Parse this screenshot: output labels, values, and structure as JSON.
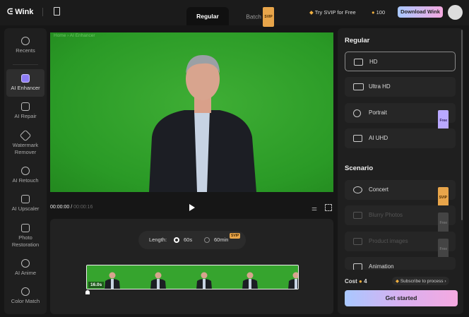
{
  "header": {
    "app_name": "Wink",
    "tabs": [
      {
        "label": "Regular"
      },
      {
        "label": "Batch",
        "badge": "SVIP"
      }
    ],
    "try_svip": "Try SVIP for Free",
    "coins": "100",
    "download": "Download Wink"
  },
  "breadcrumb": "Home  ›  AI Enhancer",
  "sidebar": {
    "items": [
      {
        "label": "Recents",
        "icon": "history-icon"
      },
      {
        "label": "AI Enhancer",
        "icon": "hd-icon"
      },
      {
        "label": "AI Repair",
        "icon": "repair-icon"
      },
      {
        "label": "Watermark Remover",
        "icon": "eraser-icon"
      },
      {
        "label": "AI Retouch",
        "icon": "retouch-icon"
      },
      {
        "label": "AI Upscaler",
        "icon": "4k-icon"
      },
      {
        "label": "Photo Restoration",
        "icon": "photo-icon"
      },
      {
        "label": "AI Anime",
        "icon": "anime-icon"
      },
      {
        "label": "Color Match",
        "icon": "color-icon"
      }
    ]
  },
  "player": {
    "current_time": "00:00:00",
    "separator": " / ",
    "total_time": "00:00:16"
  },
  "editor": {
    "length_label": "Length:",
    "options": [
      {
        "label": "60s",
        "selected": true
      },
      {
        "label": "60min",
        "badge": "SVIP",
        "selected": false
      }
    ],
    "clip_duration": "16.0s"
  },
  "panel": {
    "regular_title": "Regular",
    "regular": [
      {
        "label": "HD",
        "selected": true
      },
      {
        "label": "Ultra HD"
      },
      {
        "label": "Portrait",
        "badge": "Free"
      },
      {
        "label": "AI UHD"
      }
    ],
    "scenario_title": "Scenario",
    "scenario": [
      {
        "label": "Concert",
        "badge": "SVIP"
      },
      {
        "label": "Blurry Photos",
        "badge": "Free",
        "disabled": true
      },
      {
        "label": "Product images",
        "badge": "Free",
        "disabled": true
      },
      {
        "label": "Animation"
      }
    ],
    "cost_label": "Cost",
    "cost_value": "4",
    "subscribe": "Subscribe to process ›",
    "cta": "Get started"
  },
  "colors": {
    "accent_gradient": [
      "#a9c8ff",
      "#f5a9e0"
    ],
    "green_screen": "#2fa12a",
    "svip": "#e8a54a"
  }
}
